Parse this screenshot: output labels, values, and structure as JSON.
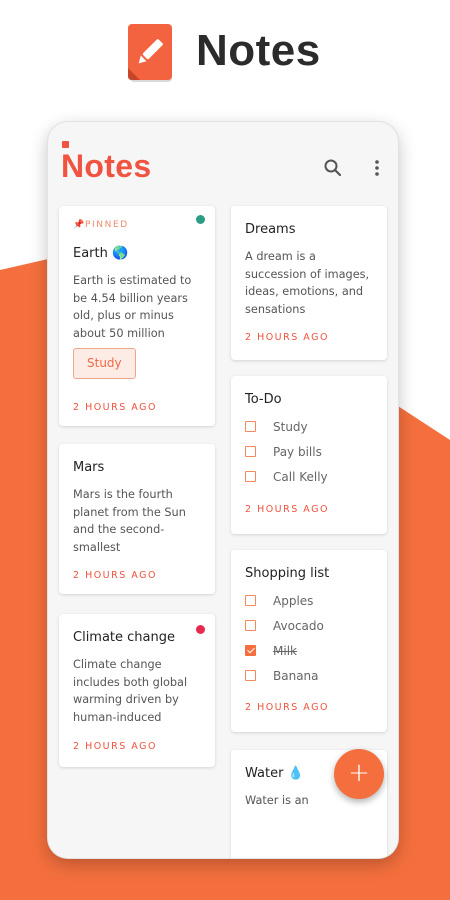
{
  "store": {
    "app_title": "Notes"
  },
  "app": {
    "brand": {
      "first": "N",
      "rest": "otes"
    },
    "accent_color": "#f0533f",
    "icons": [
      "search-icon",
      "more-vert-icon",
      "pin-icon",
      "plus-icon"
    ]
  },
  "notes": {
    "earth": {
      "pinned_label": "PINNED",
      "title": "Earth 🌎",
      "body": "Earth is estimated to be 4.54 billion years old, plus or minus about 50 million",
      "tag": "Study",
      "time": "2 HOURS AGO",
      "dot_color": "#2a9d83"
    },
    "mars": {
      "title": "Mars",
      "body": "Mars is the fourth planet from the Sun and the second-smallest",
      "time": "2 HOURS AGO"
    },
    "climate": {
      "title": "Climate change",
      "body": "Climate change includes both global warming driven by human-induced",
      "time": "2 HOURS AGO",
      "dot_color": "#e8284f"
    },
    "dreams": {
      "title": "Dreams",
      "body": "A dream is a succession of images, ideas, emotions, and sensations",
      "time": "2 HOURS AGO"
    },
    "todo": {
      "title": "To-Do",
      "items": [
        {
          "label": "Study",
          "checked": false
        },
        {
          "label": "Pay bills",
          "checked": false
        },
        {
          "label": "Call Kelly",
          "checked": false
        }
      ],
      "time": "2 HOURS AGO"
    },
    "shopping": {
      "title": "Shopping list",
      "items": [
        {
          "label": "Apples",
          "checked": false
        },
        {
          "label": "Avocado",
          "checked": false
        },
        {
          "label": "Milk",
          "checked": true
        },
        {
          "label": "Banana",
          "checked": false
        }
      ],
      "time": "2 HOURS AGO"
    },
    "water": {
      "title": "Water 💧",
      "body": "Water is an"
    }
  },
  "fab": {
    "label": "+"
  }
}
